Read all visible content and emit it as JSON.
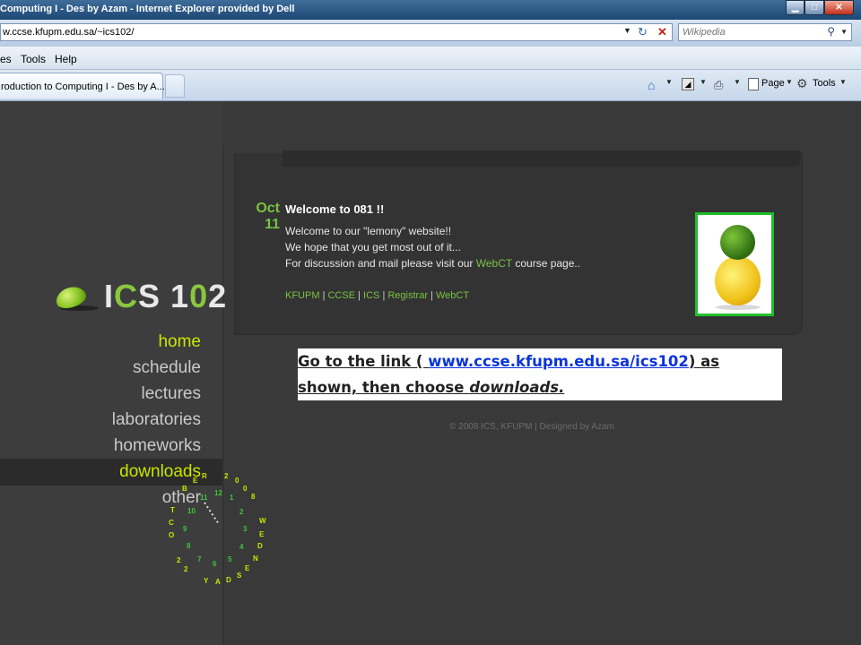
{
  "window": {
    "title": "Computing I - Des by Azam - Internet Explorer provided by Dell",
    "controls": {
      "minimize": "▁",
      "maximize": "□",
      "close": "✕"
    }
  },
  "address_bar": {
    "url": "w.ccse.kfupm.edu.sa/~ics102/"
  },
  "search_box": {
    "placeholder": "Wikipedia"
  },
  "menu": {
    "items": [
      "es",
      "Tools",
      "Help"
    ]
  },
  "tab": {
    "title": "roduction to Computing I - Des by A..."
  },
  "command_bar": {
    "page_label": "Page",
    "tools_label": "Tools"
  },
  "site": {
    "logo_text": {
      "i": "I",
      "c": "C",
      "s": "S",
      "num1": "1",
      "num2": "0",
      "num3": "2"
    },
    "nav": [
      {
        "label": "home",
        "active": true
      },
      {
        "label": "schedule"
      },
      {
        "label": "lectures"
      },
      {
        "label": "laboratories"
      },
      {
        "label": "homeworks"
      },
      {
        "label": "downloads",
        "active": true
      },
      {
        "label": "other"
      }
    ],
    "date": {
      "month": "Oct",
      "day": "11"
    },
    "welcome": {
      "title": "Welcome to 081 !!",
      "line1": "Welcome to our \"lemony\" website!!",
      "line2": "We hope that you get most out of it...",
      "line3_before": "For discussion and mail please visit our ",
      "line3_link": "WebCT",
      "line3_after": " course page.."
    },
    "links": [
      "KFUPM",
      "CCSE",
      "ICS",
      "Registrar",
      "WebCT"
    ],
    "link_separator": "|",
    "copyright": "© 2008 ICS, KFUPM | Designed by Azam"
  },
  "callout": {
    "before": "Go to the link  ( ",
    "link": "www.ccse.kfupm.edu.sa/ics102",
    "middle": ") as shown, then choose ",
    "emphasis": "downloads."
  },
  "clock": {
    "labels": [
      {
        "t": "R",
        "c": "#c8e600"
      },
      {
        "t": "E",
        "c": "#c8e600"
      },
      {
        "t": "B",
        "c": "#c8e600"
      },
      {
        "t": "T",
        "c": "#c8e600"
      },
      {
        "t": "C",
        "c": "#c8e600"
      },
      {
        "t": "O",
        "c": "#c8e600"
      },
      {
        "t": "2",
        "c": "#c8e600"
      },
      {
        "t": "2",
        "c": "#c8e600"
      },
      {
        "t": "Y",
        "c": "#c8e600"
      },
      {
        "t": "A",
        "c": "#c8e600"
      },
      {
        "t": "D",
        "c": "#c8e600"
      },
      {
        "t": "S",
        "c": "#c8e600"
      },
      {
        "t": "E",
        "c": "#c8e600"
      },
      {
        "t": "N",
        "c": "#c8e600"
      },
      {
        "t": "D",
        "c": "#c8e600"
      },
      {
        "t": "E",
        "c": "#c8e600"
      },
      {
        "t": "W",
        "c": "#c8e600"
      },
      {
        "t": "8",
        "c": "#c8e600"
      },
      {
        "t": "0",
        "c": "#c8e600"
      },
      {
        "t": "0",
        "c": "#c8e600"
      },
      {
        "t": "2",
        "c": "#c8e600"
      },
      {
        "t": "12",
        "c": "#3ec23e"
      },
      {
        "t": "1",
        "c": "#3ec23e"
      },
      {
        "t": "2",
        "c": "#3ec23e"
      },
      {
        "t": "3",
        "c": "#3ec23e"
      },
      {
        "t": "4",
        "c": "#3ec23e"
      },
      {
        "t": "5",
        "c": "#3ec23e"
      },
      {
        "t": "6",
        "c": "#3ec23e"
      },
      {
        "t": "7",
        "c": "#3ec23e"
      },
      {
        "t": "8",
        "c": "#3ec23e"
      },
      {
        "t": "9",
        "c": "#3ec23e"
      },
      {
        "t": "10",
        "c": "#3ec23e"
      },
      {
        "t": "11",
        "c": "#3ec23e"
      }
    ]
  },
  "colors": {
    "accent_green": "#7ac143",
    "nav_active": "#c8e600",
    "photo_border": "#1fbf2b",
    "callout_link": "#0b35d8"
  }
}
